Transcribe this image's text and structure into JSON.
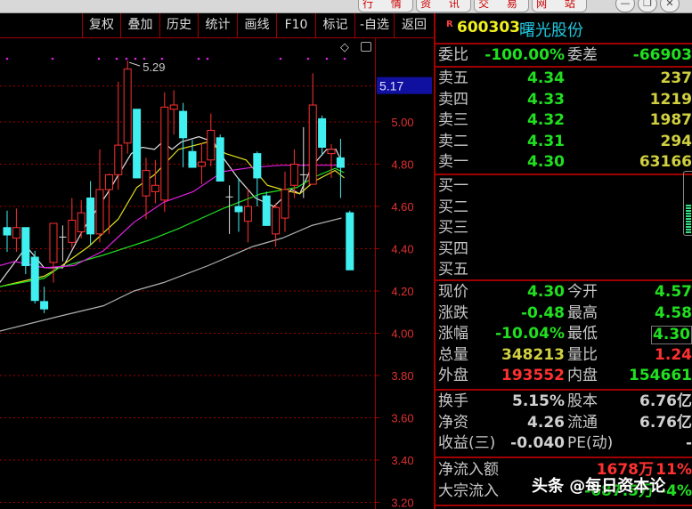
{
  "window": {
    "tabs": [
      "行 情",
      "资 讯",
      "交 易",
      "网 站"
    ],
    "controls": [
      "minimize",
      "restore",
      "close"
    ]
  },
  "toolbar": {
    "buttons": [
      "复权",
      "叠加",
      "历史",
      "统计",
      "画线",
      "F10",
      "标记",
      "-自选",
      "返回"
    ]
  },
  "chart_icons": {
    "diamond": "◇",
    "toggle": "▯"
  },
  "header": {
    "badge": "R",
    "code": "600303",
    "name": "曙光股份"
  },
  "weibi": {
    "label": "委比",
    "value": "-100.00%",
    "label2": "委差",
    "value2": "-66903"
  },
  "sells": [
    {
      "label": "卖五",
      "price": "4.34",
      "vol": "237"
    },
    {
      "label": "卖四",
      "price": "4.33",
      "vol": "1219"
    },
    {
      "label": "卖三",
      "price": "4.32",
      "vol": "1987"
    },
    {
      "label": "卖二",
      "price": "4.31",
      "vol": "294"
    },
    {
      "label": "卖一",
      "price": "4.30",
      "vol": "63166"
    }
  ],
  "buys": [
    {
      "label": "买一"
    },
    {
      "label": "买二"
    },
    {
      "label": "买三"
    },
    {
      "label": "买四"
    },
    {
      "label": "买五"
    }
  ],
  "buy_sell_gauge": 0.45,
  "quote": [
    {
      "l1": "现价",
      "v1": "4.30",
      "c1": "g",
      "l2": "今开",
      "v2": "4.57",
      "c2": "g"
    },
    {
      "l1": "涨跌",
      "v1": "-0.48",
      "c1": "g",
      "l2": "最高",
      "v2": "4.58",
      "c2": "g"
    },
    {
      "l1": "涨幅",
      "v1": "-10.04%",
      "c1": "g",
      "l2": "最低",
      "v2": "4.30",
      "c2": "g"
    },
    {
      "l1": "总量",
      "v1": "348213",
      "c1": "y",
      "l2": "量比",
      "v2": "1.24",
      "c2": "r"
    },
    {
      "l1": "外盘",
      "v1": "193552",
      "c1": "r",
      "l2": "内盘",
      "v2": "154661",
      "c2": "g"
    }
  ],
  "fundamentals": [
    {
      "l1": "换手",
      "v1": "5.15%",
      "l2": "股本",
      "v2": "6.76亿"
    },
    {
      "l1": "净资",
      "v1": "4.26",
      "l2": "流通",
      "v2": "6.76亿"
    },
    {
      "l1": "收益(三)",
      "v1": "-0.040",
      "l2": "PE(动)",
      "v2": "-"
    }
  ],
  "flows": [
    {
      "label": "净流入额",
      "value": "1678万",
      "pct": "11%",
      "c": "r"
    },
    {
      "label": "大宗流入",
      "value": "-687.5万",
      "pct": "-4%",
      "c": "g"
    }
  ],
  "watermark": "头条 @每日资本论",
  "chart_data": {
    "type": "candlestick",
    "y_ticks": [
      "5.00",
      "4.80",
      "4.60",
      "4.40",
      "4.20",
      "4.00",
      "3.80",
      "3.60",
      "3.40",
      "3.20"
    ],
    "ylim": [
      3.18,
      5.37
    ],
    "current_price_label": "5.17",
    "high_annotation": "5.29",
    "candles": [
      [
        4.5,
        4.58,
        4.385,
        4.465
      ],
      [
        4.45,
        4.59,
        4.385,
        4.5
      ],
      [
        4.5,
        4.5,
        4.28,
        4.32
      ],
      [
        4.36,
        4.39,
        4.14,
        4.155
      ],
      [
        4.15,
        4.22,
        4.095,
        4.115
      ],
      [
        4.335,
        4.52,
        4.24,
        4.52
      ],
      [
        4.455,
        4.51,
        4.34,
        4.455
      ],
      [
        4.43,
        4.64,
        4.405,
        4.535
      ],
      [
        4.48,
        4.63,
        4.45,
        4.57
      ],
      [
        4.64,
        4.72,
        4.42,
        4.47
      ],
      [
        4.47,
        4.87,
        4.43,
        4.68
      ],
      [
        4.68,
        4.755,
        4.47,
        4.75
      ],
      [
        4.75,
        5.19,
        4.68,
        4.89
      ],
      [
        4.9,
        5.29,
        4.85,
        5.25
      ],
      [
        5.06,
        5.06,
        4.735,
        4.735
      ],
      [
        4.65,
        4.83,
        4.54,
        4.77
      ],
      [
        4.67,
        4.82,
        4.615,
        4.7
      ],
      [
        4.63,
        5.14,
        4.575,
        5.07
      ],
      [
        5.06,
        5.15,
        4.94,
        5.08
      ],
      [
        5.05,
        5.09,
        4.785,
        4.925
      ],
      [
        4.86,
        4.915,
        4.785,
        4.785
      ],
      [
        4.79,
        4.9,
        4.705,
        4.81
      ],
      [
        4.82,
        5.04,
        4.79,
        4.96
      ],
      [
        4.925,
        4.94,
        4.72,
        4.72
      ],
      [
        4.645,
        4.7,
        4.47,
        4.645
      ],
      [
        4.6,
        4.735,
        4.48,
        4.575
      ],
      [
        4.53,
        4.685,
        4.43,
        4.6
      ],
      [
        4.85,
        4.86,
        4.6,
        4.735
      ],
      [
        4.65,
        4.67,
        4.51,
        4.51
      ],
      [
        4.47,
        4.615,
        4.41,
        4.595
      ],
      [
        4.545,
        4.765,
        4.48,
        4.68
      ],
      [
        4.7,
        4.87,
        4.64,
        4.8
      ],
      [
        4.75,
        4.975,
        4.64,
        4.75
      ],
      [
        4.705,
        5.23,
        4.705,
        5.08
      ],
      [
        5.015,
        5.03,
        4.84,
        4.88
      ],
      [
        4.85,
        4.895,
        4.735,
        4.87
      ],
      [
        4.83,
        4.92,
        4.64,
        4.785
      ],
      [
        4.57,
        4.58,
        4.3,
        4.3
      ]
    ],
    "ma": [
      {
        "name": "MA5",
        "color": "#e0e0e0",
        "points": [
          [
            -0.8,
            4.24
          ],
          [
            2.1,
            4.41
          ],
          [
            4,
            4.31
          ],
          [
            6,
            4.31
          ],
          [
            8.2,
            4.49
          ],
          [
            10.8,
            4.66
          ],
          [
            13.4,
            4.85
          ],
          [
            14.6,
            4.88
          ],
          [
            15.9,
            4.87
          ],
          [
            16.8,
            4.905
          ],
          [
            17.8,
            4.87
          ],
          [
            18.8,
            4.905
          ],
          [
            20.7,
            4.93
          ],
          [
            22.3,
            4.905
          ],
          [
            23,
            4.85
          ],
          [
            24.9,
            4.735
          ],
          [
            26.8,
            4.64
          ],
          [
            28.8,
            4.6
          ],
          [
            30.7,
            4.68
          ],
          [
            31.6,
            4.66
          ],
          [
            32.9,
            4.79
          ],
          [
            34.5,
            4.87
          ],
          [
            35.5,
            4.87
          ],
          [
            36.4,
            4.785
          ]
        ]
      },
      {
        "name": "MA10",
        "color": "#e0e020",
        "points": [
          [
            -0.8,
            4.22
          ],
          [
            4,
            4.27
          ],
          [
            5.6,
            4.31
          ],
          [
            8.8,
            4.41
          ],
          [
            12,
            4.54
          ],
          [
            14,
            4.69
          ],
          [
            15.9,
            4.75
          ],
          [
            18.5,
            4.87
          ],
          [
            21.7,
            4.905
          ],
          [
            23.6,
            4.85
          ],
          [
            25.8,
            4.82
          ],
          [
            28.1,
            4.7
          ],
          [
            29.7,
            4.68
          ],
          [
            31.6,
            4.66
          ],
          [
            33.2,
            4.72
          ],
          [
            35.4,
            4.77
          ],
          [
            36.4,
            4.735
          ]
        ]
      },
      {
        "name": "MA20",
        "color": "#20e020",
        "points": [
          [
            -0.8,
            4.22
          ],
          [
            4,
            4.26
          ],
          [
            5.6,
            4.31
          ],
          [
            10.4,
            4.37
          ],
          [
            15.3,
            4.44
          ],
          [
            18.5,
            4.495
          ],
          [
            23.3,
            4.59
          ],
          [
            27.4,
            4.66
          ],
          [
            31.3,
            4.69
          ],
          [
            33.2,
            4.74
          ],
          [
            35.4,
            4.78
          ],
          [
            36.4,
            4.76
          ]
        ]
      },
      {
        "name": "MA30",
        "color": "#e020e0",
        "points": [
          [
            -0.8,
            4.32
          ],
          [
            0.8,
            4.34
          ],
          [
            4,
            4.31
          ],
          [
            7.2,
            4.32
          ],
          [
            10.4,
            4.39
          ],
          [
            13.7,
            4.525
          ],
          [
            16.9,
            4.62
          ],
          [
            20.1,
            4.67
          ],
          [
            23.3,
            4.765
          ],
          [
            26.5,
            4.785
          ],
          [
            29.7,
            4.795
          ],
          [
            36.1,
            4.795
          ]
        ]
      },
      {
        "name": "MA60",
        "color": "#b0b0b0",
        "points": [
          [
            -0.8,
            4.01
          ],
          [
            5.6,
            4.08
          ],
          [
            10.4,
            4.13
          ],
          [
            13.7,
            4.2
          ],
          [
            16.9,
            4.24
          ],
          [
            21.7,
            4.32
          ],
          [
            26.5,
            4.41
          ],
          [
            29.7,
            4.45
          ],
          [
            32.9,
            4.51
          ],
          [
            36.1,
            4.545
          ]
        ]
      }
    ]
  },
  "colors": {
    "up": "#ff3030",
    "down": "#40f0f0",
    "grid": "#a00000",
    "marker": "#e020e0"
  }
}
